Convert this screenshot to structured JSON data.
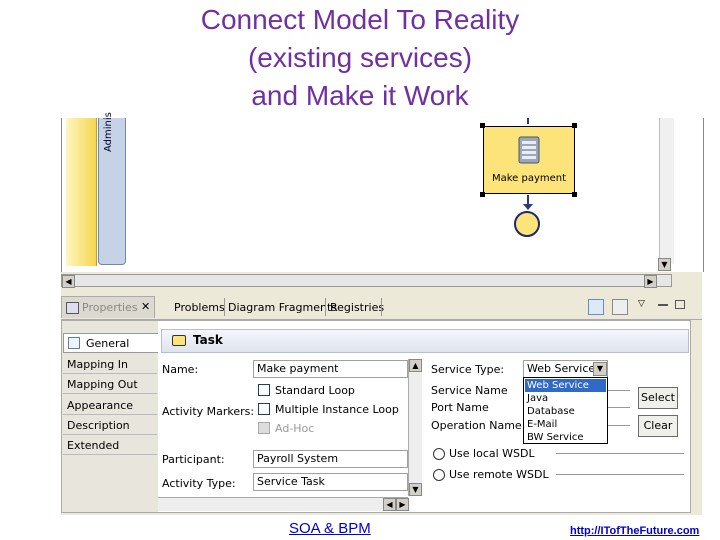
{
  "title": {
    "line1": "Connect Model To Reality",
    "line2": "(existing services)",
    "line3": "and Make it Work"
  },
  "diagram": {
    "lane_label": "Adminis",
    "task_label": "Make payment"
  },
  "properties_view": {
    "tab_label": "Properties",
    "other_tabs": [
      "Problems",
      "Diagram Fragments",
      "Registries"
    ],
    "side_tabs": [
      "General",
      "Mapping In",
      "Mapping Out",
      "Appearance",
      "Description",
      "Extended"
    ],
    "section_title": "Task",
    "name_label": "Name:",
    "name_value": "Make payment",
    "activity_markers_label": "Activity Markers:",
    "markers": [
      "Standard Loop",
      "Multiple Instance Loop",
      "Ad-Hoc"
    ],
    "participant_label": "Participant:",
    "participant_value": "Payroll System",
    "activity_type_label": "Activity Type:",
    "activity_type_value": "Service Task",
    "service_type_label": "Service Type:",
    "service_type_value": "Web Service",
    "service_type_options": [
      "Web Service",
      "Java",
      "Database",
      "E-Mail",
      "BW Service"
    ],
    "service_name_label": "Service Name",
    "port_name_label": "Port Name",
    "operation_name_label": "Operation Name",
    "select_button": "Select",
    "clear_button": "Clear",
    "radio_local": "Use local WSDL",
    "radio_remote": "Use remote WSDL"
  },
  "footer": {
    "left_link": "SOA & BPM",
    "right_link": "http://ITofTheFuture.com"
  },
  "colors": {
    "title": "#7030a0",
    "task_fill": "#fde47a",
    "footer_link": "#0000cc",
    "selection": "#316ac5"
  }
}
